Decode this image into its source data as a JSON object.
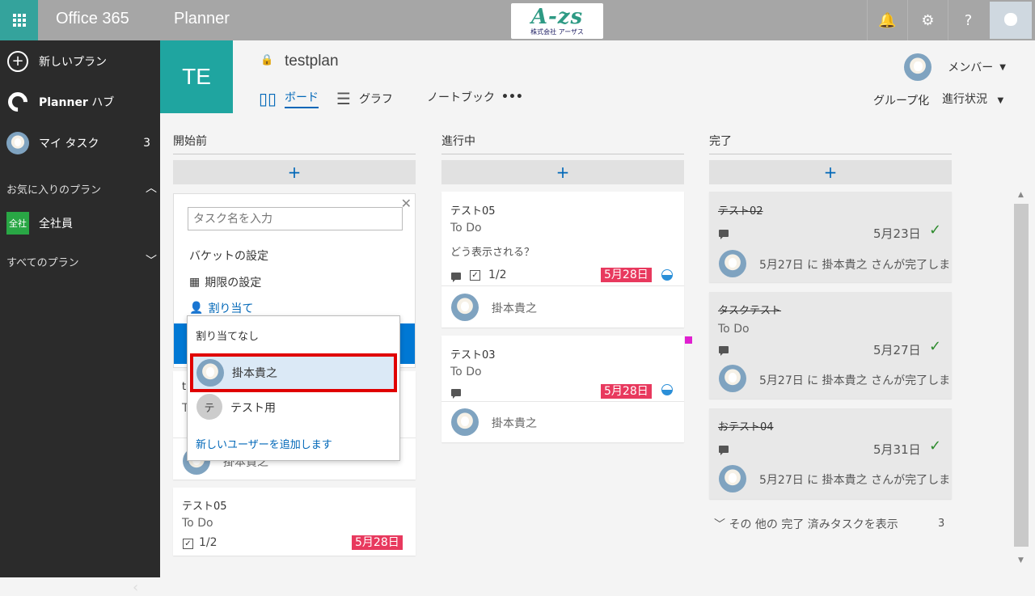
{
  "topbar": {
    "app_launcher": "app-launcher",
    "suite": "Office 365",
    "app": "Planner",
    "logo_main": "A-zs",
    "logo_sub": "株式会社 アーザス",
    "icons": [
      "bell-icon",
      "gear-icon",
      "help-icon"
    ],
    "help_glyph": "?"
  },
  "sidebar": {
    "new_plan": "新しいプラン",
    "hub_bold": "Planner",
    "hub_rest": " ハブ",
    "my_tasks": "マイ タスク",
    "my_tasks_count": "3",
    "favorites_header": "お気に入りのプラン",
    "favorite_badge": "全社",
    "favorite_name": "全社員",
    "all_plans": "すべてのプラン"
  },
  "plan": {
    "tile": "TE",
    "name": "testplan",
    "tabs": [
      "ボード",
      "グラフ",
      "ノートブック"
    ],
    "more": "•••",
    "members": "メンバー",
    "group_by": "グループ化",
    "progress": "進行状況"
  },
  "buckets": [
    {
      "title": "開始前",
      "add": "+",
      "newtask": {
        "placeholder": "タスク名を入力",
        "bucket_setting": "バケットの設定",
        "due_setting": "期限の設定",
        "assign": "割り当て"
      },
      "cards": [
        {
          "title": "テスト05",
          "sub": "To Do",
          "check": "1/2",
          "due": "5月28日"
        }
      ]
    },
    {
      "title": "進行中",
      "add": "+",
      "cards": [
        {
          "title": "テスト05",
          "sub": "To Do",
          "desc": "どう表示される？",
          "check": "1/2",
          "due": "5月28日",
          "assignee": "掛本貴之"
        },
        {
          "title": "テスト03",
          "sub": "To Do",
          "due": "5月28日",
          "assignee": "掛本貴之"
        }
      ]
    },
    {
      "title": "完了",
      "add": "+",
      "cards": [
        {
          "title": "テスト02",
          "date": "5月23日",
          "note": "5月27日 に 掛本貴之 さんが完了しま"
        },
        {
          "title": "タスクテスト",
          "sub": "To Do",
          "date": "5月27日",
          "note": "5月27日 に 掛本貴之 さんが完了しま"
        },
        {
          "title": "おテスト04",
          "date": "5月31日",
          "note": "5月27日 に 掛本貴之 さんが完了しま"
        }
      ],
      "show_more": "その 他の 完了 済みタスクを表示",
      "show_more_count": "3"
    }
  ],
  "dropdown": {
    "unassigned": "割り当てなし",
    "user1": "掛本貴之",
    "user2_initial": "テ",
    "user2": "テスト用",
    "add_user": "新しいユーザーを追加します"
  },
  "hidden_card": {
    "title_initial": "t",
    "sub_initial": "T",
    "assignee_partial": "掛本貴之"
  },
  "colors": {
    "accent_teal": "#1fa5a0",
    "sidebar": "#2b2b2b",
    "link_blue": "#0067b8",
    "due_red": "#e8395e",
    "highlight_red": "#e00000"
  }
}
